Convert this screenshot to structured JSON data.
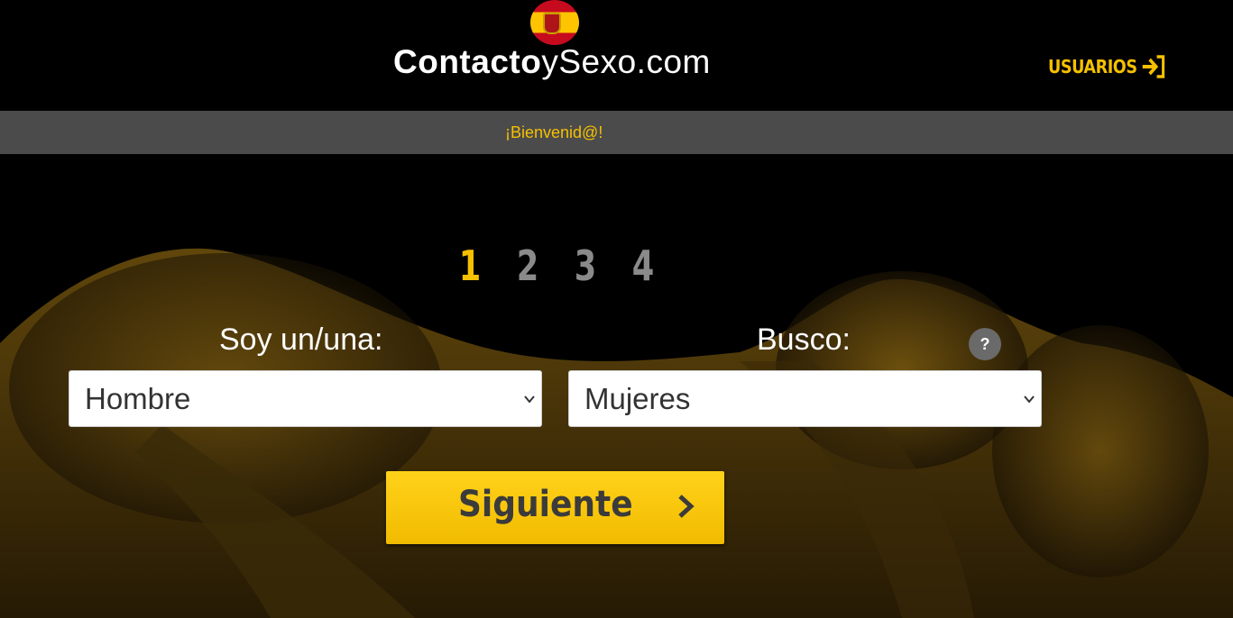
{
  "header": {
    "logo": {
      "part1": "Contacto",
      "part2": "y",
      "part3": "Sexo",
      "part4": ".com"
    },
    "users_link": "USUARIOS"
  },
  "welcome": {
    "text": "¡Bienvenid@!"
  },
  "steps": [
    "1",
    "2",
    "3",
    "4"
  ],
  "active_step": 1,
  "form": {
    "soy_label": "Soy un/una:",
    "soy_value": "Hombre",
    "busco_label": "Busco:",
    "busco_value": "Mujeres",
    "help_label": "?",
    "next_label": "Siguiente"
  },
  "colors": {
    "accent": "#f5c000",
    "bar": "#4b4b4b",
    "button": "#ffd21a"
  },
  "icons": [
    "spain-flag-icon",
    "sign-in-arrow-icon",
    "question-icon",
    "chevron-down-icon",
    "chevron-right-icon"
  ]
}
